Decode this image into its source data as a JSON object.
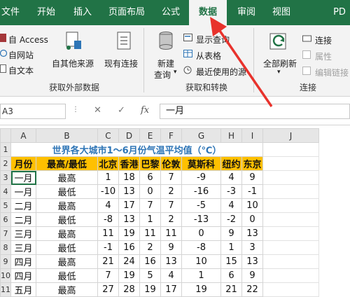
{
  "tabs": [
    "文件",
    "开始",
    "插入",
    "页面布局",
    "公式",
    "数据",
    "审阅",
    "视图",
    "PD"
  ],
  "ribbon": {
    "access": "自 Access",
    "web": "自网站",
    "text": "自文本",
    "other_sources": "自其他来源",
    "existing_connections": "现有连接",
    "new_query": "新建",
    "new_query2": "查询",
    "show_query": "显示查询",
    "from_table": "从表格",
    "recent_sources": "最近使用的源",
    "refresh_all": "全部刷新",
    "connections": "连接",
    "properties": "属性",
    "edit_links": "编辑链接",
    "group_external": "获取外部数据",
    "group_transform": "获取和转换",
    "group_connections": "连接"
  },
  "formula_bar": {
    "name_box": "A3",
    "cancel": "✕",
    "enter": "✓",
    "fx": "fx",
    "value": "一月"
  },
  "columns": [
    "A",
    "B",
    "C",
    "D",
    "E",
    "F",
    "G",
    "H",
    "I",
    "J"
  ],
  "row_numbers": [
    "1",
    "2",
    "3",
    "4",
    "5",
    "6",
    "7",
    "8",
    "9",
    "10",
    "11"
  ],
  "sheet": {
    "title": "世界各大城市1～6月份气温平均值（℃）",
    "headers": [
      "月份",
      "最高/最低",
      "北京",
      "香港",
      "巴黎",
      "伦敦",
      "莫斯科",
      "纽约",
      "东京"
    ],
    "rows": [
      [
        "一月",
        "最高",
        "1",
        "18",
        "6",
        "7",
        "-9",
        "4",
        "9"
      ],
      [
        "一月",
        "最低",
        "-10",
        "13",
        "0",
        "2",
        "-16",
        "-3",
        "-1"
      ],
      [
        "二月",
        "最高",
        "4",
        "17",
        "7",
        "7",
        "-5",
        "4",
        "10"
      ],
      [
        "二月",
        "最低",
        "-8",
        "13",
        "1",
        "2",
        "-13",
        "-2",
        "0"
      ],
      [
        "三月",
        "最高",
        "11",
        "19",
        "11",
        "11",
        "0",
        "9",
        "13"
      ],
      [
        "三月",
        "最低",
        "-1",
        "16",
        "2",
        "9",
        "-8",
        "1",
        "3"
      ],
      [
        "四月",
        "最高",
        "21",
        "24",
        "16",
        "13",
        "10",
        "15",
        "13"
      ],
      [
        "四月",
        "最低",
        "7",
        "19",
        "5",
        "4",
        "1",
        "6",
        "9"
      ],
      [
        "五月",
        "最高",
        "27",
        "28",
        "19",
        "17",
        "19",
        "21",
        "22"
      ]
    ]
  },
  "colors": {
    "accent": "#217346",
    "header_fill": "#ffc000",
    "title": "#2e75b6",
    "arrow": "#e8322c"
  }
}
